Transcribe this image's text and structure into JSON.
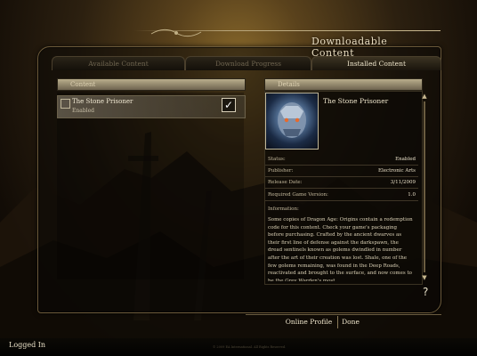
{
  "header": {
    "title": "Downloadable Content"
  },
  "tabs": [
    {
      "label": "Available Content",
      "active": false
    },
    {
      "label": "Download Progress",
      "active": false
    },
    {
      "label": "Installed Content",
      "active": true
    }
  ],
  "content_list": {
    "header": "Content",
    "items": [
      {
        "title": "The Stone Prisoner",
        "status": "Enabled",
        "checked": true
      }
    ]
  },
  "details": {
    "header": "Details",
    "title": "The Stone Prisoner",
    "properties": [
      {
        "label": "Status:",
        "value": "Enabled"
      },
      {
        "label": "Publisher:",
        "value": "Electronic Arts"
      },
      {
        "label": "Release Date:",
        "value": "3/11/2009"
      },
      {
        "label": "Required Game Version:",
        "value": "1.0"
      }
    ],
    "info_label": "Information:",
    "info_text": "Some copies of Dragon Age: Origins contain a redemption code for this content. Check your game's packaging before purchasing. Crafted by the ancient dwarves as their first line of defense against the darkspawn, the dread sentinels known as golems dwindled in number after the art of their creation was lost. Shale, one of the few golems remaining, was found in the Deep Roads, reactivated and brought to the surface, and now comes to be the Grey Warden's most"
  },
  "help_label": "?",
  "bottom_buttons": {
    "online_profile": "Online Profile",
    "done": "Done"
  },
  "status_bar": {
    "logged_in": "Logged In",
    "copyright": "© 2009 EA International. All Rights Reserved."
  },
  "colors": {
    "accent": "#e8dcc0",
    "panel": "#0c0a06",
    "tab_active": "#efe6cc"
  },
  "icons": [
    "content-icon",
    "checkmark-icon",
    "golem-portrait",
    "scroll-up-icon",
    "scroll-down-icon",
    "help-icon"
  ]
}
